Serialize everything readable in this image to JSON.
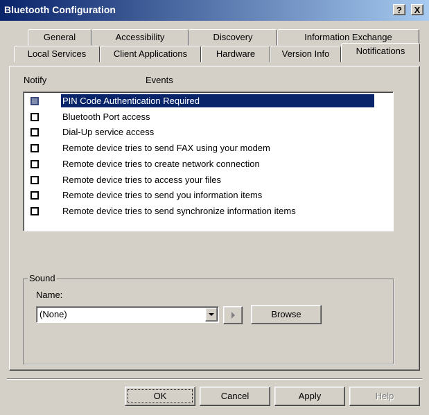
{
  "window": {
    "title": "Bluetooth Configuration",
    "help_btn": "?",
    "close_btn": "X"
  },
  "tabs_back": [
    "General",
    "Accessibility",
    "Discovery",
    "Information Exchange"
  ],
  "tabs_front": [
    "Local Services",
    "Client Applications",
    "Hardware",
    "Version Info",
    "Notifications"
  ],
  "columns": {
    "notify": "Notify",
    "events": "Events"
  },
  "events": [
    {
      "label": "PIN Code Authentication Required",
      "checked": false,
      "selected": true
    },
    {
      "label": "Bluetooth Port access",
      "checked": false,
      "selected": false
    },
    {
      "label": "Dial-Up service access",
      "checked": false,
      "selected": false
    },
    {
      "label": "Remote device tries to send FAX using your modem",
      "checked": false,
      "selected": false
    },
    {
      "label": "Remote device tries to create network connection",
      "checked": false,
      "selected": false
    },
    {
      "label": "Remote device tries to access your files",
      "checked": false,
      "selected": false
    },
    {
      "label": "Remote device tries to send you information items",
      "checked": false,
      "selected": false
    },
    {
      "label": "Remote device tries to send synchronize information items",
      "checked": false,
      "selected": false
    }
  ],
  "sound": {
    "group_label": "Sound",
    "name_label": "Name:",
    "selected": "(None)",
    "browse": "Browse"
  },
  "buttons": {
    "ok": "OK",
    "cancel": "Cancel",
    "apply": "Apply",
    "help": "Help"
  }
}
